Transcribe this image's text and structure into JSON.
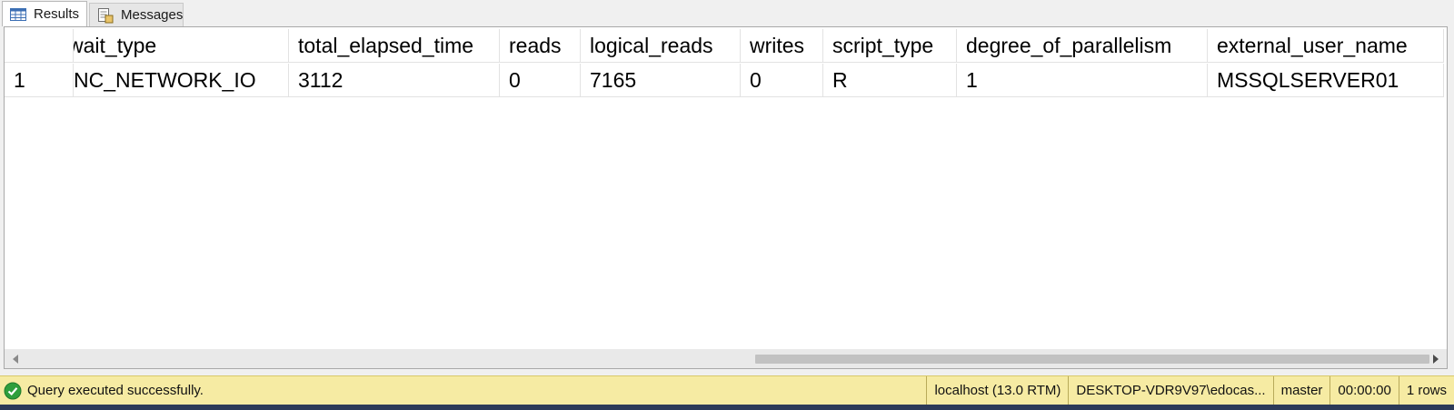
{
  "tabs": [
    {
      "label": "Results",
      "active": true,
      "icon": "grid-icon"
    },
    {
      "label": "Messages",
      "active": false,
      "icon": "messages-icon"
    }
  ],
  "grid": {
    "columns": [
      {
        "label": "",
        "width": 76
      },
      {
        "label": "wait_type",
        "width": 237
      },
      {
        "label": "total_elapsed_time",
        "width": 232
      },
      {
        "label": "reads",
        "width": 89
      },
      {
        "label": "logical_reads",
        "width": 176
      },
      {
        "label": "writes",
        "width": 91
      },
      {
        "label": "script_type",
        "width": 147
      },
      {
        "label": "degree_of_parallelism",
        "width": 276
      },
      {
        "label": "external_user_name",
        "width": 260
      }
    ],
    "rows": [
      [
        "1",
        "NC_NETWORK_IO",
        "3112",
        "0",
        "7165",
        "0",
        "R",
        "1",
        "MSSQLSERVER01"
      ]
    ]
  },
  "status": {
    "message": "Query executed successfully.",
    "server": "localhost (13.0 RTM)",
    "user": "DESKTOP-VDR9V97\\edocas...",
    "database": "master",
    "elapsed": "00:00:00",
    "rows": "1 rows"
  },
  "colors": {
    "status_bg": "#f6eba3",
    "ok_green": "#2e9e3c"
  }
}
